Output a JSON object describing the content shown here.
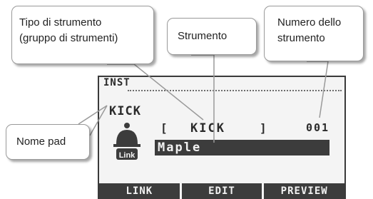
{
  "lcd": {
    "title": "INST",
    "pad_name": "KICK",
    "bracket_open": "[",
    "group": "KICK",
    "bracket_close": "]",
    "number": "001",
    "instrument": "Maple",
    "pad_icon_label": "Link",
    "function_buttons": [
      "LINK",
      "EDIT",
      "PREVIEW"
    ]
  },
  "callouts": {
    "type_line1": "Tipo di strumento",
    "type_line2": "(gruppo di strumenti)",
    "instrument": "Strumento",
    "number_line1": "Numero dello",
    "number_line2": "strumento",
    "pad_name": "Nome pad"
  },
  "colors": {
    "lcd_background": "#f4f4f4",
    "lcd_dark": "#3c3c3c",
    "callout_border": "#9a9a9a"
  }
}
